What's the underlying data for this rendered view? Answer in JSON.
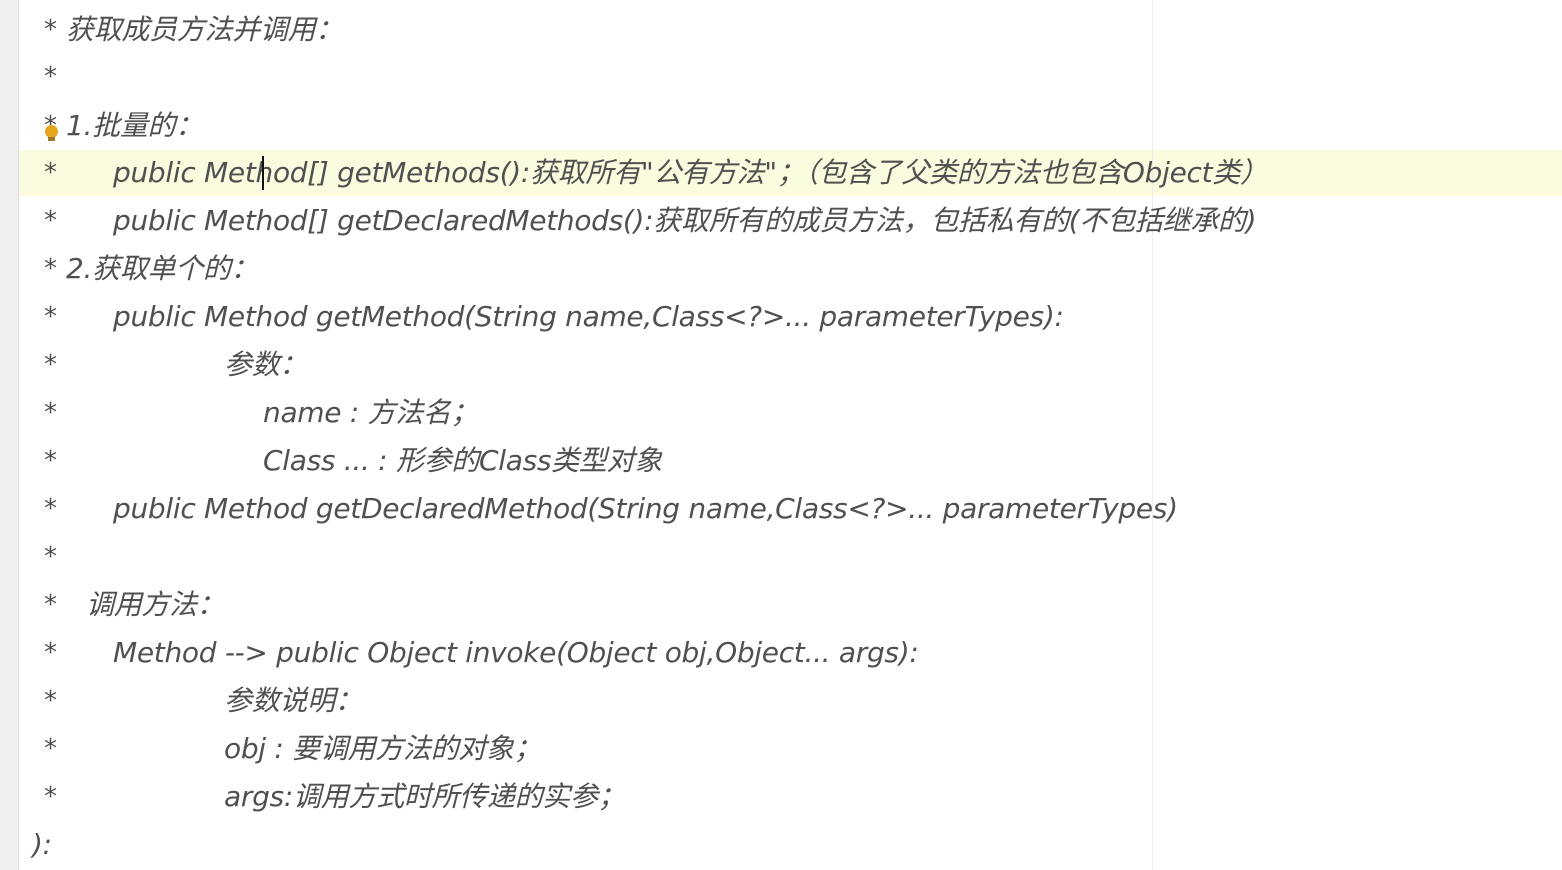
{
  "editor": {
    "colors": {
      "background": "#ffffff",
      "text": "#505050",
      "current_line_highlight": "#fbfbdf",
      "gutter": "#efefef",
      "bulb": "#e3a51c"
    },
    "lines": [
      {
        "star": "*",
        "text": "获取成员方法并调用："
      },
      {
        "star": "*",
        "text": ""
      },
      {
        "star": "*",
        "text": "1.批量的："
      },
      {
        "star": "*",
        "text": "public Method[] getMethods():获取所有\"公有方法\"；（包含了父类的方法也包含Object类）"
      },
      {
        "star": "*",
        "text": "public Method[] getDeclaredMethods():获取所有的成员方法，包括私有的(不包括继承的)"
      },
      {
        "star": "*",
        "text": "2.获取单个的："
      },
      {
        "star": "*",
        "text": "public Method getMethod(String name,Class<?>... parameterTypes):"
      },
      {
        "star": "*",
        "text": "参数："
      },
      {
        "star": "*",
        "text": "name : 方法名；"
      },
      {
        "star": "*",
        "text": "Class ... : 形参的Class类型对象"
      },
      {
        "star": "*",
        "text": "public Method getDeclaredMethod(String name,Class<?>... parameterTypes)"
      },
      {
        "star": "*",
        "text": ""
      },
      {
        "star": "*",
        "text": "调用方法："
      },
      {
        "star": "*",
        "text": "Method --> public Object invoke(Object obj,Object... args):"
      },
      {
        "star": "*",
        "text": "参数说明："
      },
      {
        "star": "*",
        "text": "obj : 要调用方法的对象；"
      },
      {
        "star": "*",
        "text": "args:调用方式时所传递的实参；"
      },
      {
        "star": "",
        "text": "):"
      }
    ],
    "intention_bulb_icon": "lightbulb-icon"
  }
}
